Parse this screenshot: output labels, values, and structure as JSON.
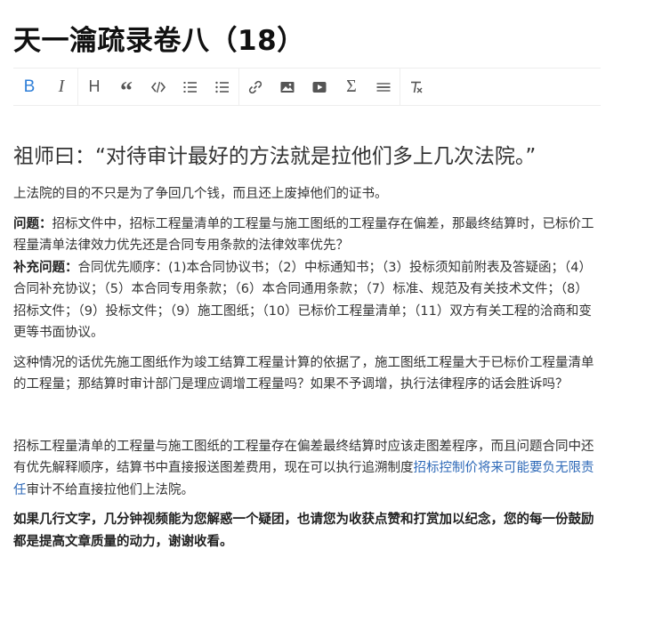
{
  "article": {
    "title": "天一瀹疏录卷八（18）"
  },
  "toolbar": {
    "buttons": [
      {
        "name": "bold",
        "icon": "bold-icon",
        "active": true
      },
      {
        "name": "italic",
        "icon": "italic-icon",
        "active": false
      },
      {
        "name": "heading",
        "icon": "heading-icon",
        "active": false
      },
      {
        "name": "quote",
        "icon": "quote-icon",
        "active": false
      },
      {
        "name": "code",
        "icon": "code-icon",
        "active": false
      },
      {
        "name": "ordered-list",
        "icon": "ordered-list-icon",
        "active": false
      },
      {
        "name": "unordered-list",
        "icon": "unordered-list-icon",
        "active": false
      },
      {
        "name": "link",
        "icon": "link-icon",
        "active": false
      },
      {
        "name": "image",
        "icon": "image-icon",
        "active": false
      },
      {
        "name": "video",
        "icon": "video-icon",
        "active": false
      },
      {
        "name": "formula",
        "icon": "sigma-icon",
        "active": false
      },
      {
        "name": "divider",
        "icon": "horizontal-rule-icon",
        "active": false
      },
      {
        "name": "clear-format",
        "icon": "clear-format-icon",
        "active": false
      }
    ],
    "active_color": "#2f7fd8",
    "icon_color": "#555555"
  },
  "body": {
    "heading": "祖师曰：“对待审计最好的方法就是拉他们多上几次法院。”",
    "p1": "上法院的目的不只是为了争回几个钱，而且还上废掉他们的证书。",
    "question_label": "问题：",
    "question_text": "招标文件中，招标工程量清单的工程量与施工图纸的工程量存在偏差，那最终结算时，已标价工程量清单法律效力优先还是合同专用条款的法律效率优先？",
    "supplement_label": "补充问题：",
    "supplement_text": "合同优先顺序：(1)本合同协议书；（2）中标通知书；（3）投标须知前附表及答疑函；（4）合同补充协议；（5）本合同专用条款；（6）本合同通用条款；（7）标准、规范及有关技术文件；（8）招标文件；（9）投标文件；（9）施工图纸；（10）已标价工程量清单；（11）双方有关工程的洽商和变更等书面协议。",
    "p3": "这种情况的话优先施工图纸作为竣工结算工程量计算的依据了，施工图纸工程量大于已标价工程量清单的工程量；那结算时审计部门是理应调增工程量吗？如果不予调增，执行法律程序的话会胜诉吗？",
    "p4_before": "招标工程量清单的工程量与施工图纸的工程量存在偏差最终结算时应该走图差程序，而且问题合同中还有优先解释顺序，结算书中直接报送图差费用，现在可以执行追溯制度",
    "p4_link": "招标控制价将来可能要负无限责任",
    "p4_after": "审计不给直接拉他们上法院。",
    "p5": "如果几行文字，几分钟视频能为您解惑一个疑团，也请您为收获点赞和打赏加以纪念，您的每一份鼓励都是提高文章质量的动力，谢谢收看。",
    "link_color": "#2f6ab8"
  }
}
